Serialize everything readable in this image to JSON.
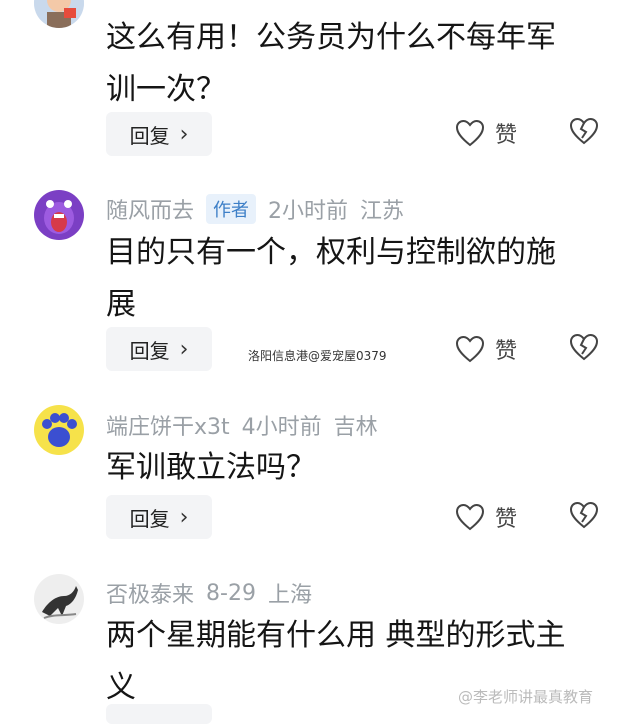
{
  "comments": [
    {
      "user": "",
      "is_author": false,
      "time": "",
      "location": "",
      "text_lines": [
        "这么有用！公务员为什么不每年军",
        "训一次？"
      ],
      "avatar": "cartoon-person-avatar"
    },
    {
      "user": "随风而去",
      "is_author": true,
      "author_label": "作者",
      "time": "2小时前",
      "location": "江苏",
      "text_lines": [
        "目的只有一个，权利与控制欲的施",
        "展"
      ],
      "avatar": "purple-monster-avatar"
    },
    {
      "user": "端庄饼干x3t",
      "is_author": false,
      "time": "4小时前",
      "location": "吉林",
      "text_lines": [
        "军训敢立法吗？"
      ],
      "avatar": "blue-paw-avatar"
    },
    {
      "user": "否极泰来",
      "is_author": false,
      "time": "8-29",
      "location": "上海",
      "text_lines": [
        "两个星期能有什么用 典型的形式主",
        "义"
      ],
      "avatar": "ink-horse-avatar"
    }
  ],
  "actions": {
    "reply_label": "回复",
    "like_label": "赞"
  },
  "watermarks": {
    "middle": "洛阳信息港@爱宠屋0379",
    "bottom_right": "@李老师讲最真教育"
  },
  "colors": {
    "meta": "#9aa0a6",
    "author_tag_bg": "#e8f1fb",
    "author_tag_text": "#3d7fc7",
    "button_bg": "#f3f4f6"
  }
}
